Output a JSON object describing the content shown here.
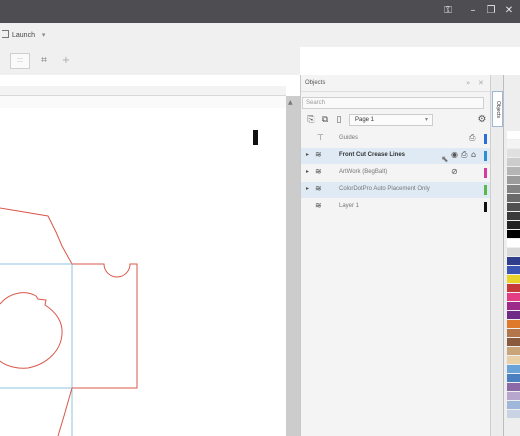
{
  "menubar": {
    "launch_label": "Launch",
    "launch_dropdown": "▾"
  },
  "objects_panel": {
    "title": "Objects",
    "search_placeholder": "Search",
    "page_select": "Page 1",
    "dock_tab_label": "Objects",
    "layers": [
      {
        "name": "Guides",
        "color": "#2b6fd6",
        "bold": false,
        "selected": false,
        "controls": "⎙"
      },
      {
        "name": "Front Cut  Crease Lines",
        "color": "#2e8fd8",
        "bold": true,
        "selected": true,
        "controls": "👁 ⎙ 🔒"
      },
      {
        "name": "ArtWork (BegBalt)",
        "color": "#d43ca0",
        "bold": false,
        "selected": false,
        "controls": "⊘"
      },
      {
        "name": "ColorDotPro Auto Placement Only",
        "color": "#59b84a",
        "bold": false,
        "selected": true,
        "controls": ""
      },
      {
        "name": "Layer 1",
        "color": "#111111",
        "bold": false,
        "selected": false,
        "controls": ""
      }
    ]
  },
  "palette_colors": [
    "#ffffff",
    "#f4f4f4",
    "#e0e0e0",
    "#cccccc",
    "#b5b5b5",
    "#9c9c9c",
    "#838383",
    "#6a6a6a",
    "#515151",
    "#3a3a3a",
    "#222222",
    "#000000",
    "#ffffff",
    "#d9d9d9",
    "#2f3e8c",
    "#3b55b3",
    "#e8d52b",
    "#c73a3a",
    "#e33d86",
    "#9c2a8a",
    "#6e2a86",
    "#e07a2b",
    "#b2764a",
    "#8a5a3d",
    "#caa57a",
    "#e8d1a8",
    "#6aa3d8",
    "#4a7fc0",
    "#8c6aa8",
    "#b7a7cf",
    "#9fb7d8",
    "#c9d3e3"
  ]
}
